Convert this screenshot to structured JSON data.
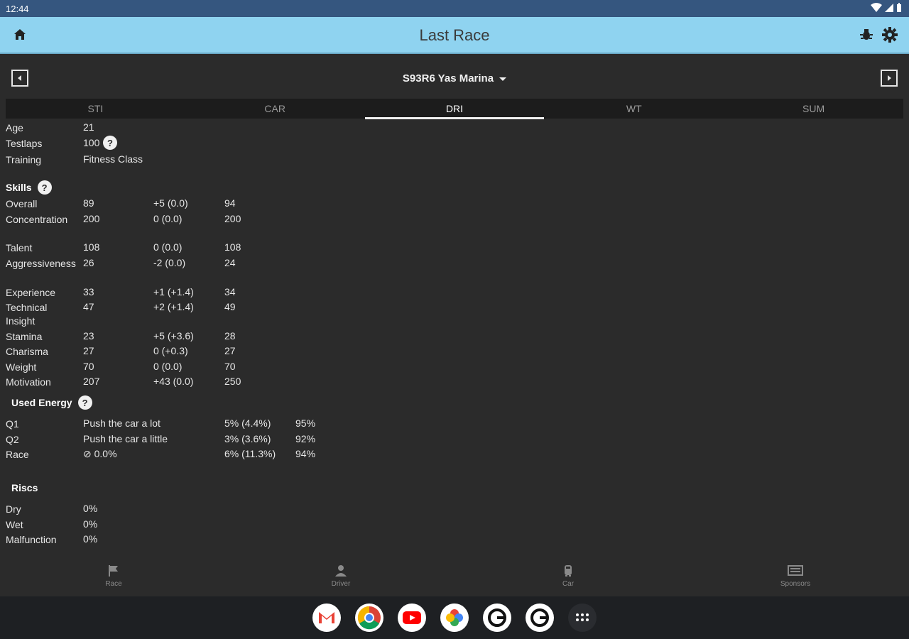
{
  "status": {
    "time": "12:44"
  },
  "appbar": {
    "title": "Last Race"
  },
  "race": {
    "selected": "S93R6 Yas Marina"
  },
  "tabs": [
    "STI",
    "CAR",
    "DRI",
    "WT",
    "SUM"
  ],
  "driver": [
    {
      "label": "Age",
      "value": "21"
    },
    {
      "label": "Testlaps",
      "value": "100"
    },
    {
      "label": "Training",
      "value": "Fitness Class"
    }
  ],
  "skills": {
    "title": "Skills",
    "rows": [
      {
        "label": "Overall",
        "start": "89",
        "change": "+5 (0.0)",
        "end": "94"
      },
      {
        "label": "Concentration",
        "start": "200",
        "change": "0 (0.0)",
        "end": "200"
      },
      {
        "label": "Talent",
        "start": "108",
        "change": "0 (0.0)",
        "end": "108"
      },
      {
        "label": "Aggressiveness",
        "start": "26",
        "change": "-2 (0.0)",
        "end": "24"
      },
      {
        "label": "Experience",
        "start": "33",
        "change": "+1 (+1.4)",
        "end": "34"
      },
      {
        "label": "Technical Insight",
        "start": "47",
        "change": "+2 (+1.4)",
        "end": "49"
      },
      {
        "label": "Stamina",
        "start": "23",
        "change": "+5 (+3.6)",
        "end": "28"
      },
      {
        "label": "Charisma",
        "start": "27",
        "change": "0 (+0.3)",
        "end": "27"
      },
      {
        "label": "Weight",
        "start": "70",
        "change": "0 (0.0)",
        "end": "70"
      },
      {
        "label": "Motivation",
        "start": "207",
        "change": "+43 (0.0)",
        "end": "250"
      }
    ]
  },
  "energy": {
    "title": "Used Energy",
    "rows": [
      {
        "label": "Q1",
        "mode": "Push the car a lot",
        "used": "5% (4.4%)",
        "left": "95%"
      },
      {
        "label": "Q2",
        "mode": "Push the car a little",
        "used": "3% (3.6%)",
        "left": "92%"
      },
      {
        "label": "Race",
        "mode": "⊘ 0.0%",
        "used": "6% (11.3%)",
        "left": "94%"
      }
    ]
  },
  "risks": {
    "title": "Riscs",
    "rows": [
      {
        "label": "Dry",
        "value": "0%"
      },
      {
        "label": "Wet",
        "value": "0%"
      },
      {
        "label": "Malfunction",
        "value": "0%"
      }
    ]
  },
  "bottomnav": [
    "Race",
    "Driver",
    "Car",
    "Sponsors"
  ],
  "colors": {
    "appbar": "#8fd3f0",
    "statusbar": "#35567f",
    "background": "#2b2b2b"
  }
}
